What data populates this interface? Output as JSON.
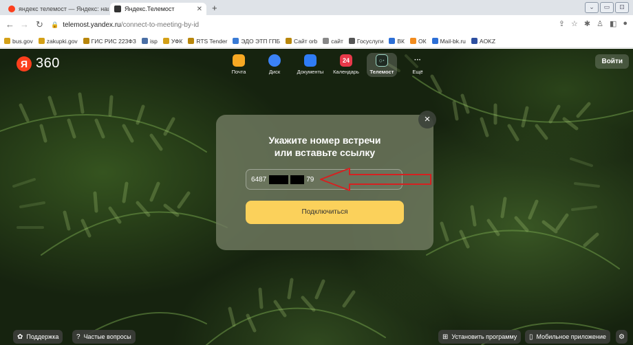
{
  "browser": {
    "tabs": [
      {
        "title": "яндекс телемост — Яндекс: нашл",
        "favicon_color": "#fc3f1d"
      },
      {
        "title": "Яндекс.Телемост",
        "favicon_color": "#333333",
        "active": true
      }
    ],
    "new_tab": "+",
    "window_buttons": [
      "⌄",
      "▭",
      "⊡"
    ],
    "url_host": "telemost.yandex.ru",
    "url_path": "/connect-to-meeting-by-id",
    "bookmarks": [
      {
        "label": "bus.gov",
        "color": "#d4a017"
      },
      {
        "label": "zakupki.gov",
        "color": "#d4a017"
      },
      {
        "label": "ГИС РИС 223ФЗ",
        "color": "#b8860b"
      },
      {
        "label": "isp",
        "color": "#4a6fa5"
      },
      {
        "label": "УФК",
        "color": "#d4a017"
      },
      {
        "label": "RTS Tender",
        "color": "#b8860b"
      },
      {
        "label": "ЭДО ЭТП ГПБ",
        "color": "#3a7bd5"
      },
      {
        "label": "Сайт orb",
        "color": "#b8860b"
      },
      {
        "label": "сайт",
        "color": "#888888"
      },
      {
        "label": "Госуслуги",
        "color": "#555555"
      },
      {
        "label": "ВК",
        "color": "#2d6fd6"
      },
      {
        "label": "ОК",
        "color": "#f28c1e"
      },
      {
        "label": "Mail-bk.ru",
        "color": "#2d6fd6"
      },
      {
        "label": "AOKZ",
        "color": "#2d4fa0"
      }
    ]
  },
  "header": {
    "logo_text": "Я",
    "logo_number": "360",
    "login_label": "Войти",
    "services": [
      {
        "label": "Почта",
        "color": "#f7a823",
        "badge": ""
      },
      {
        "label": "Диск",
        "color": "#3b82f6",
        "badge": ""
      },
      {
        "label": "Документы",
        "color": "#2f7cf6",
        "badge": ""
      },
      {
        "label": "Календарь",
        "color": "#e8394a",
        "badge": "24"
      },
      {
        "label": "Телемост",
        "color": "#1f2a22",
        "badge": "",
        "active": true
      },
      {
        "label": "Ещё",
        "color": "transparent",
        "badge": "···"
      }
    ]
  },
  "dialog": {
    "title_line1": "Укажите номер встречи",
    "title_line2": "или вставьте ссылку",
    "input_prefix": "6487",
    "input_suffix": "79",
    "connect_label": "Подключиться",
    "close_label": "×"
  },
  "footer": {
    "support_label": "Поддержка",
    "faq_label": "Частые вопросы",
    "install_label": "Установить программу",
    "mobile_label": "Мобильное приложение"
  },
  "colors": {
    "accent_yellow": "#fbd15b",
    "yandex_red": "#fc3f1d",
    "annotation_arrow": "#d62020"
  }
}
